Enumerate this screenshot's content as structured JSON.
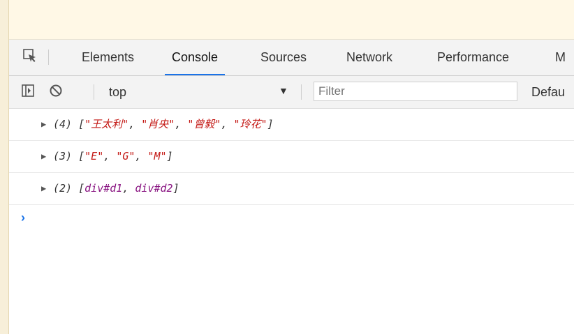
{
  "tabs": [
    {
      "label": "Elements",
      "active": false
    },
    {
      "label": "Console",
      "active": true
    },
    {
      "label": "Sources",
      "active": false
    },
    {
      "label": "Network",
      "active": false
    },
    {
      "label": "Performance",
      "active": false
    },
    {
      "label": "M",
      "active": false
    }
  ],
  "toolbar": {
    "context": "top",
    "context_arrow": "▼",
    "filter_placeholder": "Filter",
    "levels": "Defau"
  },
  "console": {
    "rows": [
      {
        "expand": "▶",
        "length": "(4)",
        "items": [
          "\"王太利\"",
          "\"肖央\"",
          "\"曾毅\"",
          "\"玲花\""
        ]
      },
      {
        "expand": "▶",
        "length": "(3)",
        "items": [
          "\"E\"",
          "\"G\"",
          "\"M\""
        ]
      },
      {
        "expand": "▶",
        "length": "(2)",
        "items": [
          "div#d1",
          "div#d2"
        ]
      }
    ],
    "prompt": "›"
  },
  "colors": {
    "accent": "#1a73e8",
    "string": "#c41a16",
    "element": "#881280",
    "banner": "#fff8e6"
  }
}
